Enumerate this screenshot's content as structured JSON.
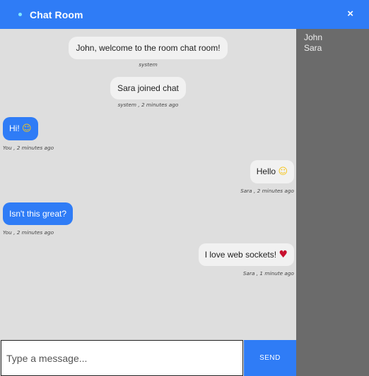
{
  "header": {
    "title": "Chat Room",
    "close_label": "×"
  },
  "users": [
    "John",
    "Sara"
  ],
  "messages": [
    {
      "text": "John, welcome to the room chat room!",
      "emoji": "",
      "meta": "system"
    },
    {
      "text": "Sara joined chat",
      "emoji": "",
      "meta": "system , 2 minutes ago"
    },
    {
      "text": "Hi!",
      "emoji": "☺",
      "meta": "You , 2 minutes ago"
    },
    {
      "text": "Hello",
      "emoji": "☺",
      "meta": "Sara , 2 minutes ago"
    },
    {
      "text": "Isn't this great?",
      "emoji": "",
      "meta": "You , 2 minutes ago"
    },
    {
      "text": "I love web sockets!",
      "emoji": "♥",
      "meta": "Sara , 1 minute ago"
    }
  ],
  "composer": {
    "placeholder": "Type a message...",
    "send_label": "SEND"
  },
  "colors": {
    "accent": "#2f7cf6",
    "background": "#dedede",
    "users_panel": "#6b6b6b"
  }
}
